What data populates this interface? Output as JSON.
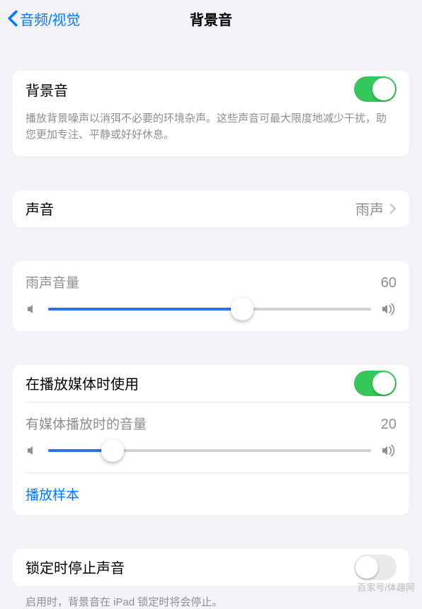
{
  "nav": {
    "back_label": "音频/视觉",
    "title": "背景音"
  },
  "main_toggle": {
    "label": "背景音",
    "enabled": true,
    "description": "播放背景噪声以消弭不必要的环境杂声。这些声音可最大限度地减少干扰，助您更加专注、平静或好好休息。"
  },
  "sound_row": {
    "label": "声音",
    "value": "雨声"
  },
  "primary_slider": {
    "label": "雨声音量",
    "value": 60
  },
  "media_section": {
    "toggle_label": "在播放媒体时使用",
    "toggle_enabled": true,
    "slider_label": "有媒体播放时的音量",
    "slider_value": 20,
    "sample_label": "播放样本"
  },
  "lock_section": {
    "toggle_label": "锁定时停止声音",
    "toggle_enabled": false,
    "description": "启用时，背景音在 iPad 锁定时将会停止。"
  },
  "watermark": "百家号/体趣网"
}
